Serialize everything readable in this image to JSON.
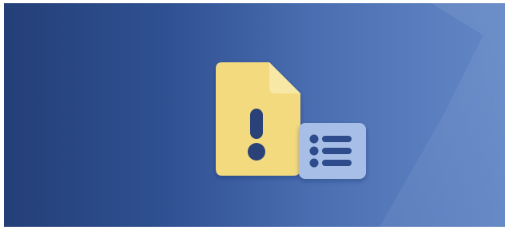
{
  "hero": {
    "colors": {
      "gradient_start": "#243f78",
      "gradient_end": "#6488c6",
      "document_fill": "#f3da7e",
      "document_mark": "#2b4378",
      "card_fill": "#a7bfe7",
      "card_mark": "#2e4c8b"
    },
    "icons": {
      "document": "document-alert-icon",
      "alert": "exclamation-icon",
      "list_card": "list-card-icon"
    }
  }
}
